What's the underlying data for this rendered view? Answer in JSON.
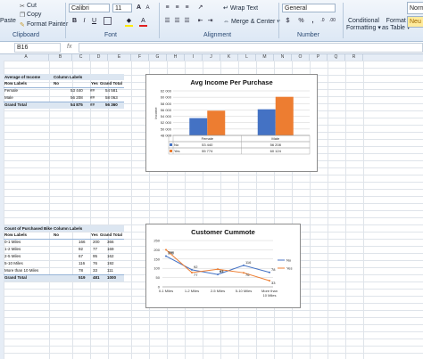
{
  "ribbon": {
    "clipboard": {
      "paste": "Paste",
      "cut": "Cut",
      "copy": "Copy",
      "format_painter": "Format Painter",
      "group": "Clipboard"
    },
    "font": {
      "name": "Calibri",
      "size": "11",
      "group": "Font",
      "bold": "B",
      "italic": "I",
      "underline": "U",
      "grow": "A",
      "shrink": "A"
    },
    "alignment": {
      "wrap_text": "Wrap Text",
      "merge_center": "Merge & Center",
      "group": "Alignment"
    },
    "number": {
      "format": "General",
      "currency": "$",
      "percent": "%",
      "comma": ",",
      "group": "Number"
    },
    "styles": {
      "conditional": "Conditional",
      "conditional2": "Formatting",
      "format_as": "Format",
      "format_as2": "as Table",
      "normal": "Norm",
      "neutral": "Neu"
    }
  },
  "formula_bar": {
    "name_box": "B16",
    "fx": "fx"
  },
  "columns": [
    "A",
    "B",
    "C",
    "D",
    "E",
    "F",
    "G",
    "H",
    "I",
    "J",
    "K",
    "L",
    "M",
    "N",
    "O",
    "P",
    "Q",
    "R"
  ],
  "pivot1": {
    "corner": "Average of Income",
    "col_labels": "Column Labels",
    "row_labels": "Row Labels",
    "no": "No",
    "yes": "Yes",
    "grand": "Grand Total",
    "rows": [
      {
        "label": "Female",
        "no": "53 440",
        "yes": "##",
        "total": "54 581"
      },
      {
        "label": "Male",
        "no": "56 208",
        "yes": "##",
        "total": "58 063"
      },
      {
        "label": "Grand Total",
        "no": "54 875",
        "yes": "##",
        "total": "56 360"
      }
    ]
  },
  "pivot2": {
    "corner": "Count of Purchased Bike",
    "col_labels": "Column Labels",
    "row_labels": "Row Labels",
    "no": "No",
    "yes": "Yes",
    "grand": "Grand Total",
    "rows": [
      {
        "label": "0-1 Miles",
        "no": "166",
        "yes": "200",
        "total": "366"
      },
      {
        "label": "1-2 Miles",
        "no": "92",
        "yes": "77",
        "total": "169"
      },
      {
        "label": "2-5 Miles",
        "no": "67",
        "yes": "95",
        "total": "162"
      },
      {
        "label": "5-10 Miles",
        "no": "116",
        "yes": "76",
        "total": "192"
      },
      {
        "label": "More than 10 Miles",
        "no": "78",
        "yes": "33",
        "total": "111"
      },
      {
        "label": "Grand Total",
        "no": "519",
        "yes": "481",
        "total": "1000"
      }
    ]
  },
  "chart_data": [
    {
      "type": "bar",
      "title": "Avg Income Per Purchase",
      "ylabel": "Income",
      "categories": [
        "Female",
        "Male"
      ],
      "series": [
        {
          "name": "No",
          "values": [
            53440,
            56208
          ],
          "labels": [
            "53 440",
            "56 208"
          ],
          "color": "#4472c4"
        },
        {
          "name": "Yes",
          "values": [
            55774,
            60124
          ],
          "labels": [
            "55 774",
            "60 124"
          ],
          "color": "#ed7d31"
        }
      ],
      "ylim": [
        48000,
        62000
      ],
      "yticks": [
        "48 000",
        "50 000",
        "52 000",
        "54 000",
        "56 000",
        "58 000",
        "60 000",
        "62 000"
      ],
      "grid": true,
      "legend": "data-table"
    },
    {
      "type": "line",
      "title": "Customer Cummote",
      "categories": [
        "0-1 Miles",
        "1-2 Miles",
        "2-5 Miles",
        "5-10 Miles",
        "More than 10 Miles"
      ],
      "series": [
        {
          "name": "No",
          "values": [
            166,
            92,
            67,
            116,
            78
          ],
          "color": "#4472c4"
        },
        {
          "name": "Yes",
          "values": [
            200,
            77,
            95,
            76,
            33
          ],
          "color": "#ed7d31"
        }
      ],
      "ylim": [
        0,
        250
      ],
      "yticks": [
        "0",
        "50",
        "100",
        "150",
        "200",
        "250"
      ],
      "grid": true,
      "legend": "right"
    }
  ]
}
